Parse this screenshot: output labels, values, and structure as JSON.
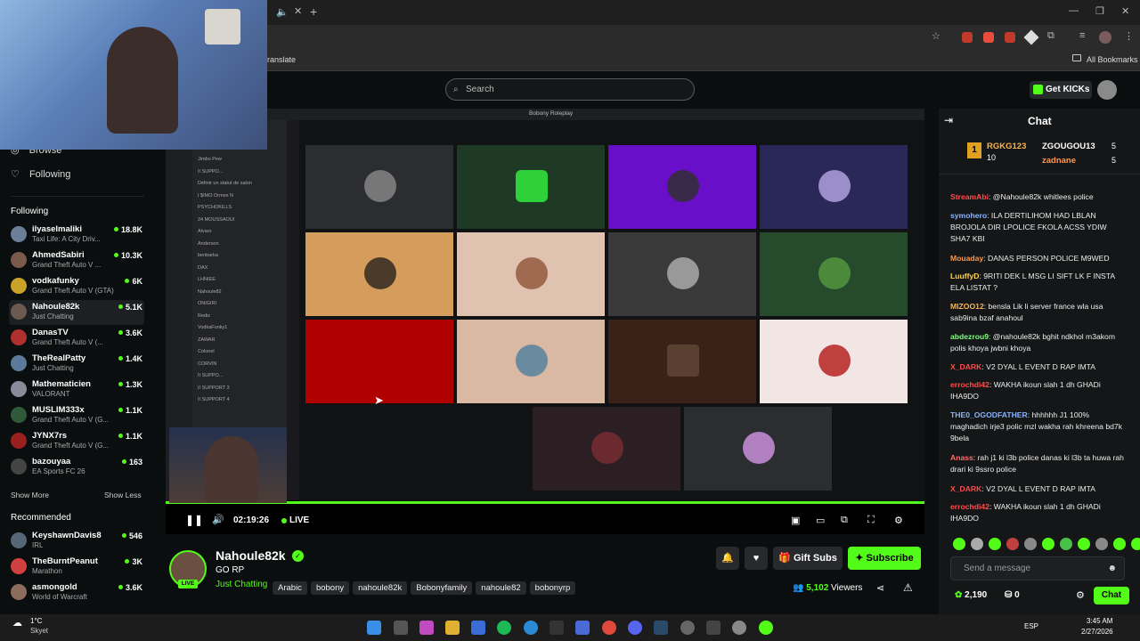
{
  "browser": {
    "bookmark_fragment": "ranslate",
    "all_bookmarks": "All Bookmarks"
  },
  "header": {
    "search_placeholder": "Search",
    "get_kicks": "Get KICKs"
  },
  "sidebar": {
    "browse": "Browse",
    "following_nav": "Following",
    "following_heading": "Following",
    "following": [
      {
        "name": "ilyaselmaliki",
        "category": "Taxi Life: A City Driv...",
        "viewers": "18.8K"
      },
      {
        "name": "AhmedSabiri",
        "category": "Grand Theft Auto V ...",
        "viewers": "10.3K"
      },
      {
        "name": "vodkafunky",
        "category": "Grand Theft Auto V (GTA)",
        "viewers": "6K"
      },
      {
        "name": "Nahoule82k",
        "category": "Just Chatting",
        "viewers": "5.1K"
      },
      {
        "name": "DanasTV",
        "category": "Grand Theft Auto V (...",
        "viewers": "3.6K"
      },
      {
        "name": "TheRealPatty",
        "category": "Just Chatting",
        "viewers": "1.4K"
      },
      {
        "name": "Mathematicien",
        "category": "VALORANT",
        "viewers": "1.3K"
      },
      {
        "name": "MUSLIM333x",
        "category": "Grand Theft Auto V (G...",
        "viewers": "1.1K"
      },
      {
        "name": "JYNX7rs",
        "category": "Grand Theft Auto V (G...",
        "viewers": "1.1K"
      },
      {
        "name": "bazouyaa",
        "category": "EA Sports FC 26",
        "viewers": "163"
      }
    ],
    "show_more": "Show More",
    "show_less": "Show Less",
    "recommended_heading": "Recommended",
    "recommended": [
      {
        "name": "KeyshawnDavis8",
        "category": "IRL",
        "viewers": "546"
      },
      {
        "name": "TheBurntPeanut",
        "category": "Marathon",
        "viewers": "3K"
      },
      {
        "name": "asmongold",
        "category": "World of Warcraft",
        "viewers": "3.6K"
      }
    ]
  },
  "player": {
    "window_title": "Bobony Roleplay",
    "time": "02:19:26",
    "live": "LIVE",
    "discord_names": [
      "Jimbo Pew",
      "II SUPPO...",
      "Définir un statut de salon",
      "I $IMO Ormes N",
      "PSYCHOKILLS",
      "24 MOUSSAOUI",
      "Alvaro",
      "Anderson",
      "benbarka",
      "DAX",
      "LHNIEE",
      "Nahoule82",
      "ONIGIRI",
      "Rediz",
      "VodkaFunky1",
      "ZAWAR",
      "Colonel",
      "CORVIN",
      "II SUPPO...",
      "II SUPPORT 3",
      "II SUPPORT 4"
    ]
  },
  "stream": {
    "name": "Nahoule82k",
    "title": "GO RP",
    "category": "Just Chatting",
    "tags": [
      "Arabic",
      "bobony",
      "nahoule82k",
      "Bobonyfamily",
      "nahoule82",
      "bobonyrp"
    ],
    "live_badge": "LIVE",
    "gift_subs": "Gift Subs",
    "subscribe": "Subscribe",
    "viewers_count": "5,102",
    "viewers_label": "Viewers"
  },
  "chat": {
    "title": "Chat",
    "leaders": [
      {
        "rank": "1",
        "name": "RGKG123",
        "count": "10"
      },
      {
        "name": "ZGOUGOU13",
        "count": "5"
      },
      {
        "name": "zadnane",
        "count": "5"
      }
    ],
    "messages": [
      {
        "user": "StreamAbi",
        "text": ": @Nahoule82k whitlees police",
        "color": "#ff4d4d"
      },
      {
        "user": "symohero",
        "text": ": ILA DERTILIHOM HAD LBLAN BROJOLA DIR LPOLICE FKOLA ACSS YDIW SHA7 KBI",
        "color": "#8ab4ff"
      },
      {
        "user": "Mouaday",
        "text": ": DANAS PERSON POLICE M9WED",
        "color": "#ff9a4d"
      },
      {
        "user": "LuuffyD",
        "text": ": 9RITI DEK L MSG LI SIFT LK F INSTA ELA LISTAT ?",
        "color": "#ffd24d"
      },
      {
        "user": "MIZOO12",
        "text": ": bensla Lik li server france wla usa sab9ina bzaf anahoul",
        "color": "#ffb34d"
      },
      {
        "user": "abdezrou9",
        "text": ": @nahoule82k bghit ndkhol m3akom polis khoya jwbni khoya",
        "color": "#7dff7d"
      },
      {
        "user": "X_DARK",
        "text": ": V2 DYAL L EVENT D RAP IMTA",
        "color": "#ff4d4d"
      },
      {
        "user": "errochdi42",
        "text": ": WAKHA ikoun slah 1 dh GHADi IHA9DO",
        "color": "#ff4d4d"
      },
      {
        "user": "THE0_OGODFATHER",
        "text": ": hhhhhh J1 100% maghadich irje3 polic mzl wakha rah khreena bd7k 9bela",
        "color": "#8ab4ff"
      },
      {
        "user": "Anass",
        "text": ": rah j1 ki l3b police danas ki l3b ta huwa rah drari ki 9ssro police",
        "color": "#ff6b6b"
      },
      {
        "user": "X_DARK",
        "text": ": V2 DYAL L EVENT D RAP IMTA",
        "color": "#ff4d4d"
      },
      {
        "user": "errochdi42",
        "text": ": WAKHA ikoun slah 1 dh GHADi IHA9DO",
        "color": "#ff4d4d"
      }
    ],
    "input_placeholder": "Send a message",
    "points": "2,190",
    "gifts": "0",
    "send": "Chat"
  },
  "taskbar": {
    "temp": "1°C",
    "weather": "Skyet",
    "lang": "ESP",
    "time": "3:45 AM",
    "date": "2/27/2026"
  },
  "colors": {
    "accent": "#53fc18"
  }
}
